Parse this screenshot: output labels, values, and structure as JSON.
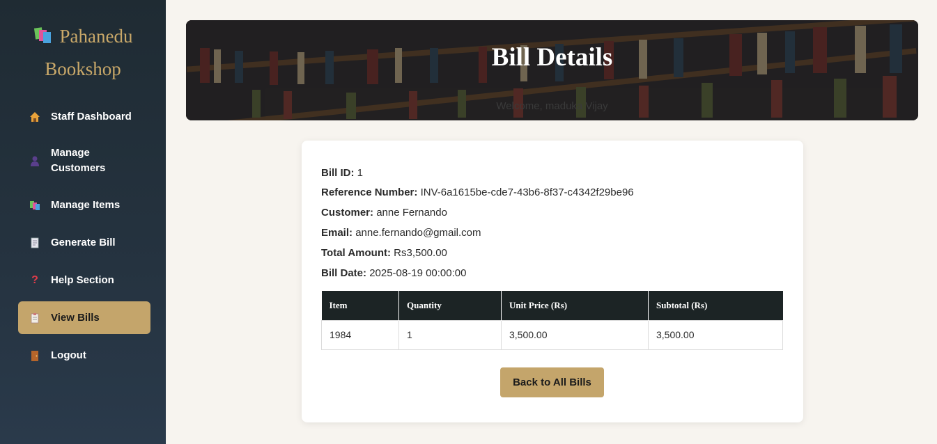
{
  "brand": {
    "name_line1": "Pahanedu",
    "name_line2": "Bookshop",
    "logo_icon": "books-icon"
  },
  "sidebar": {
    "items": [
      {
        "label": "Staff Dashboard",
        "icon": "house-icon",
        "active": false
      },
      {
        "label": "Manage Customers",
        "icon": "person-icon",
        "active": false
      },
      {
        "label": "Manage Items",
        "icon": "books-icon",
        "active": false
      },
      {
        "label": "Generate Bill",
        "icon": "receipt-icon",
        "active": false
      },
      {
        "label": "Help Section",
        "icon": "question-icon",
        "active": false
      },
      {
        "label": "View Bills",
        "icon": "clipboard-icon",
        "active": true
      },
      {
        "label": "Logout",
        "icon": "door-icon",
        "active": false
      }
    ]
  },
  "header": {
    "title": "Bill Details",
    "subtitle": "Welcome, maduka Vijay"
  },
  "bill": {
    "fields": [
      {
        "label": "Bill ID:",
        "value": "1"
      },
      {
        "label": "Reference Number:",
        "value": "INV-6a1615be-cde7-43b6-8f37-c4342f29be96"
      },
      {
        "label": "Customer:",
        "value": "anne Fernando"
      },
      {
        "label": "Email:",
        "value": "anne.fernando@gmail.com"
      },
      {
        "label": "Total Amount:",
        "value": "Rs3,500.00"
      },
      {
        "label": "Bill Date:",
        "value": "2025-08-19 00:00:00"
      }
    ],
    "table": {
      "headers": [
        "Item",
        "Quantity",
        "Unit Price (Rs)",
        "Subtotal (Rs)"
      ],
      "rows": [
        [
          "1984",
          "1",
          "3,500.00",
          "3,500.00"
        ]
      ]
    },
    "back_label": "Back to All Bills"
  },
  "colors": {
    "accent": "#c4a56b",
    "sidebar": "#1f2b33",
    "table_header": "#1c2425",
    "page_bg": "#f7f4ef"
  }
}
